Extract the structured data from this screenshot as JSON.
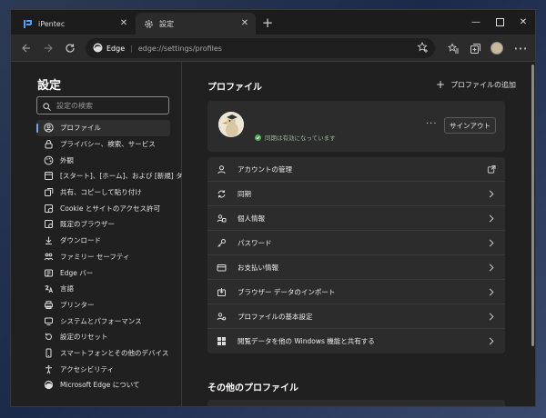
{
  "tabs": [
    {
      "label": "iPentec",
      "icon": "ipentec-icon"
    },
    {
      "label": "設定",
      "icon": "gear-icon"
    }
  ],
  "address": {
    "site": "Edge",
    "url": "edge://settings/profiles"
  },
  "sidebar": {
    "title": "設定",
    "search_placeholder": "設定の検索",
    "items": [
      {
        "label": "プロファイル",
        "icon": "profile-icon",
        "selected": true
      },
      {
        "label": "プライバシー、検索、サービス",
        "icon": "lock-icon"
      },
      {
        "label": "外観",
        "icon": "appearance-icon"
      },
      {
        "label": "[スタート]、[ホーム]、および [新規] タブ",
        "icon": "start-home-icon"
      },
      {
        "label": "共有、コピーして貼り付け",
        "icon": "share-icon"
      },
      {
        "label": "Cookie とサイトのアクセス許可",
        "icon": "cookie-icon"
      },
      {
        "label": "既定のブラウザー",
        "icon": "default-browser-icon"
      },
      {
        "label": "ダウンロード",
        "icon": "download-icon"
      },
      {
        "label": "ファミリー セーフティ",
        "icon": "family-icon"
      },
      {
        "label": "Edge バー",
        "icon": "edge-bar-icon"
      },
      {
        "label": "言語",
        "icon": "language-icon"
      },
      {
        "label": "プリンター",
        "icon": "printer-icon"
      },
      {
        "label": "システムとパフォーマンス",
        "icon": "system-icon"
      },
      {
        "label": "設定のリセット",
        "icon": "reset-icon"
      },
      {
        "label": "スマートフォンとその他のデバイス",
        "icon": "phone-icon"
      },
      {
        "label": "アクセシビリティ",
        "icon": "accessibility-icon"
      },
      {
        "label": "Microsoft Edge について",
        "icon": "edge-logo-icon"
      }
    ]
  },
  "main": {
    "title": "プロファイル",
    "add_profile": "プロファイルの追加",
    "sync_status": "同期は有効になっています",
    "sign_out": "サインアウト",
    "more": "···",
    "rows": [
      {
        "label": "アカウントの管理",
        "icon": "account-icon",
        "trailing": "external-link-icon"
      },
      {
        "label": "同期",
        "icon": "sync-icon",
        "trailing": "chevron-right-icon"
      },
      {
        "label": "個人情報",
        "icon": "personal-info-icon",
        "trailing": "chevron-right-icon"
      },
      {
        "label": "パスワード",
        "icon": "key-icon",
        "trailing": "chevron-right-icon"
      },
      {
        "label": "お支払い情報",
        "icon": "card-icon",
        "trailing": "chevron-right-icon"
      },
      {
        "label": "ブラウザー データのインポート",
        "icon": "import-icon",
        "trailing": "chevron-right-icon"
      },
      {
        "label": "プロファイルの基本設定",
        "icon": "profile-settings-icon",
        "trailing": "chevron-right-icon"
      },
      {
        "label": "閲覧データを他の Windows 機能と共有する",
        "icon": "windows-icon",
        "trailing": "chevron-right-icon"
      }
    ],
    "other_title": "その他のプロファイル"
  },
  "colors": {
    "accent": "#6aa8e6",
    "sync_ok": "#4caf50",
    "panel": "#2c2c2c",
    "background": "#202020"
  }
}
